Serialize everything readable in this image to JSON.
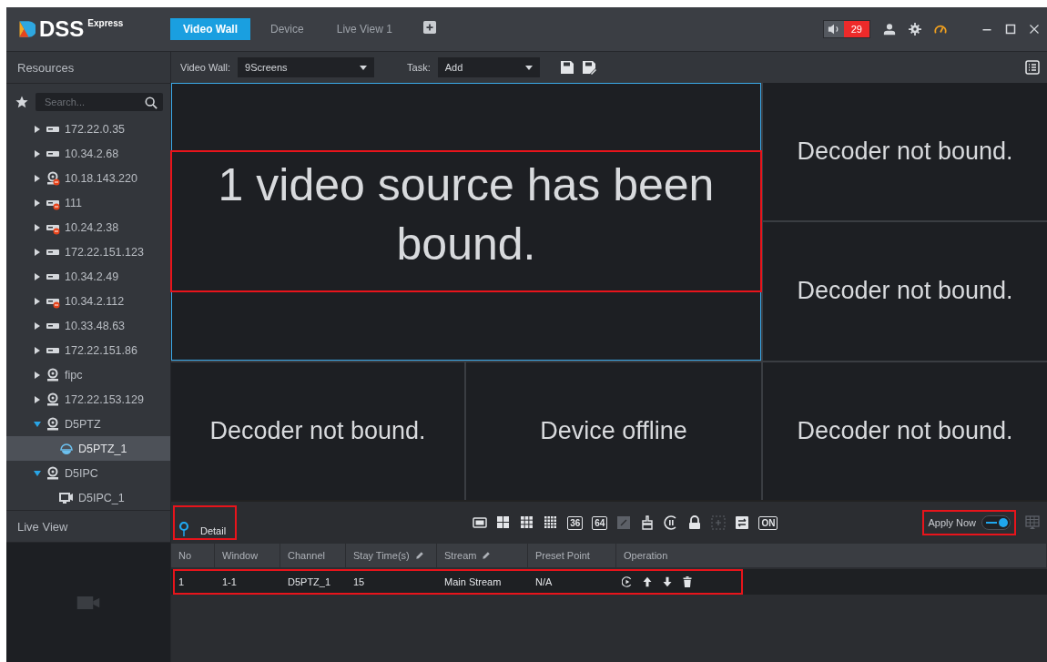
{
  "app": {
    "logo": "DSS",
    "edition": "Express"
  },
  "tabs": [
    {
      "label": "Video Wall",
      "selected": true
    },
    {
      "label": "Device",
      "selected": false
    },
    {
      "label": "Live View 1",
      "selected": false
    }
  ],
  "alarm": {
    "count": "29"
  },
  "sidebar": {
    "title": "Resources",
    "search": {
      "placeholder": "Search..."
    },
    "tree": [
      {
        "label": "172.22.0.35",
        "kind": "device",
        "offline": false,
        "expanded": false,
        "selected": false
      },
      {
        "label": "10.34.2.68",
        "kind": "device",
        "offline": false,
        "expanded": false,
        "selected": false
      },
      {
        "label": "10.18.143.220",
        "kind": "camera",
        "offline": true,
        "expanded": false,
        "selected": false
      },
      {
        "label": "111",
        "kind": "device",
        "offline": true,
        "expanded": false,
        "selected": false
      },
      {
        "label": "10.24.2.38",
        "kind": "device",
        "offline": true,
        "expanded": false,
        "selected": false
      },
      {
        "label": "172.22.151.123",
        "kind": "device",
        "offline": false,
        "expanded": false,
        "selected": false
      },
      {
        "label": "10.34.2.49",
        "kind": "device",
        "offline": false,
        "expanded": false,
        "selected": false
      },
      {
        "label": "10.34.2.112",
        "kind": "device",
        "offline": true,
        "expanded": false,
        "selected": false
      },
      {
        "label": "10.33.48.63",
        "kind": "device",
        "offline": false,
        "expanded": false,
        "selected": false
      },
      {
        "label": "172.22.151.86",
        "kind": "device",
        "offline": false,
        "expanded": false,
        "selected": false
      },
      {
        "label": "fipc",
        "kind": "camera",
        "offline": false,
        "expanded": false,
        "selected": false
      },
      {
        "label": "172.22.153.129",
        "kind": "camera",
        "offline": false,
        "expanded": false,
        "selected": false
      },
      {
        "label": "D5PTZ",
        "kind": "camera",
        "offline": false,
        "expanded": true,
        "selected": false,
        "children": [
          {
            "label": "D5PTZ_1",
            "kind": "dome",
            "offline": false,
            "selected": true
          }
        ]
      },
      {
        "label": "D5IPC",
        "kind": "camera",
        "offline": false,
        "expanded": true,
        "selected": false,
        "children": [
          {
            "label": "D5IPC_1",
            "kind": "channel",
            "offline": false,
            "selected": false
          }
        ]
      }
    ],
    "live_view_title": "Live View"
  },
  "toolbar": {
    "wall_label": "Video Wall:",
    "wall_value": "9Screens",
    "task_label": "Task:",
    "task_value": "Add"
  },
  "tiles": [
    {
      "text": "1 video source has been bound.",
      "kind": "merged",
      "selected": true,
      "highlighted": true
    },
    {
      "text": "Decoder not bound.",
      "kind": "single",
      "selected": false,
      "highlighted": false
    },
    {
      "text": "Decoder not bound.",
      "kind": "single",
      "selected": false,
      "highlighted": false
    },
    {
      "text": "Decoder not bound.",
      "kind": "single",
      "selected": false,
      "highlighted": false
    },
    {
      "text": "Device offline",
      "kind": "single",
      "selected": false,
      "highlighted": false
    },
    {
      "text": "Decoder not bound.",
      "kind": "single",
      "selected": false,
      "highlighted": false
    }
  ],
  "detail": {
    "label": "Detail"
  },
  "tools": [
    {
      "kind": "split1",
      "disabled": false
    },
    {
      "kind": "split4",
      "disabled": false
    },
    {
      "kind": "split9",
      "disabled": false
    },
    {
      "kind": "split16",
      "disabled": false
    },
    {
      "kind": "number",
      "label": "36",
      "disabled": false
    },
    {
      "kind": "number",
      "label": "64",
      "disabled": false
    },
    {
      "kind": "edit",
      "disabled": true
    },
    {
      "kind": "clear",
      "disabled": false
    },
    {
      "kind": "pause",
      "disabled": false
    },
    {
      "kind": "lock",
      "disabled": false
    },
    {
      "kind": "add",
      "disabled": true
    },
    {
      "kind": "swap",
      "disabled": false
    },
    {
      "kind": "number",
      "label": "ON",
      "disabled": false
    }
  ],
  "apply_now": {
    "label": "Apply Now",
    "on": true
  },
  "table": {
    "columns": [
      {
        "label": "No",
        "editable": false
      },
      {
        "label": "Window",
        "editable": false
      },
      {
        "label": "Channel",
        "editable": false
      },
      {
        "label": "Stay Time(s)",
        "editable": true
      },
      {
        "label": "Stream",
        "editable": true
      },
      {
        "label": "Preset Point",
        "editable": false
      },
      {
        "label": "Operation",
        "editable": false
      }
    ],
    "rows": [
      {
        "cells": [
          "1",
          "1-1",
          "D5PTZ_1",
          "15",
          "Main Stream",
          "N/A"
        ],
        "highlighted": true
      }
    ]
  }
}
